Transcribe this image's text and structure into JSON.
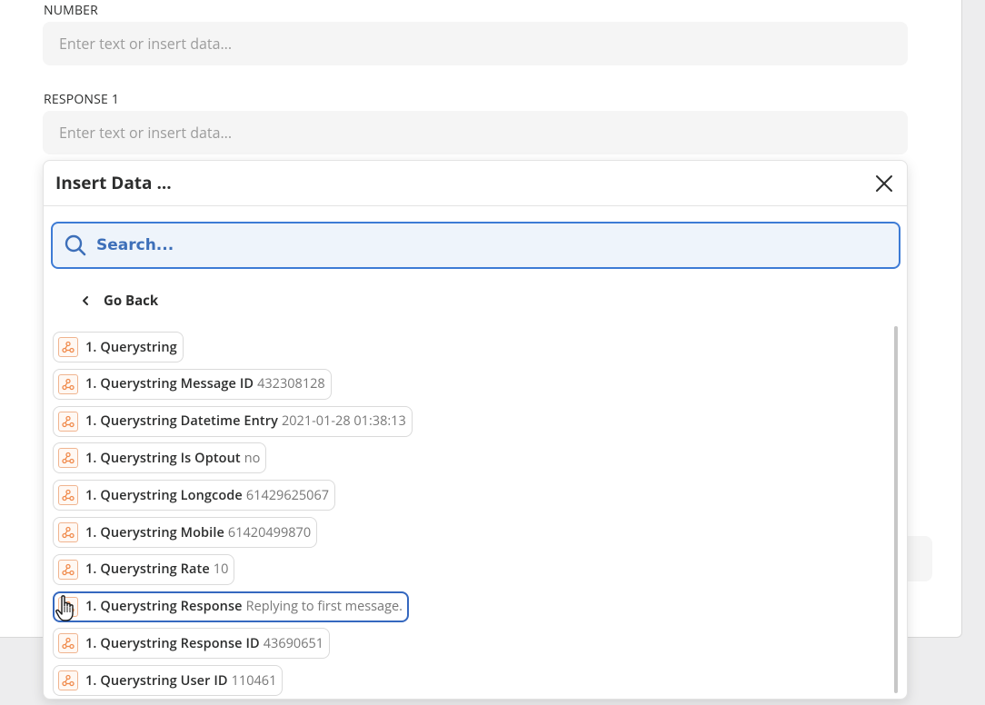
{
  "fields": {
    "number": {
      "label": "NUMBER",
      "placeholder": "Enter text or insert data..."
    },
    "response1": {
      "label": "RESPONSE 1",
      "placeholder": "Enter text or insert data..."
    }
  },
  "insert_data": {
    "title": "Insert Data ...",
    "search_placeholder": "Search...",
    "go_back_label": "Go Back",
    "items": [
      {
        "label": "1. Querystring",
        "value": ""
      },
      {
        "label": "1. Querystring Message ID",
        "value": "432308128"
      },
      {
        "label": "1. Querystring Datetime Entry",
        "value": "2021-01-28 01:38:13"
      },
      {
        "label": "1. Querystring Is Optout",
        "value": "no"
      },
      {
        "label": "1. Querystring Longcode",
        "value": "61429625067"
      },
      {
        "label": "1. Querystring Mobile",
        "value": "61420499870"
      },
      {
        "label": "1. Querystring Rate",
        "value": "10"
      },
      {
        "label": "1. Querystring Response",
        "value": "Replying to first message."
      },
      {
        "label": "1. Querystring Response ID",
        "value": "43690651"
      },
      {
        "label": "1. Querystring User ID",
        "value": "110461"
      }
    ],
    "app_icon": "webhook-icon"
  },
  "colors": {
    "accent": "#3d7bd5",
    "app_icon_orange": "#f08a4b"
  }
}
